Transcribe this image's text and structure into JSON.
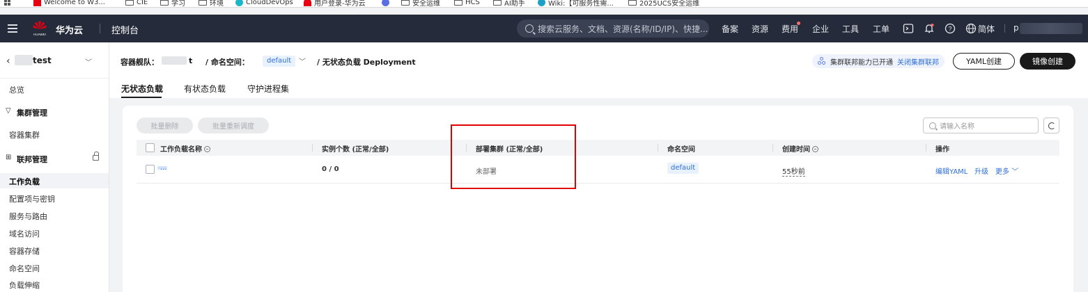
{
  "bookmarks": [
    {
      "label": "Welcome to W3...",
      "icon": "w3-icon"
    },
    {
      "label": "CIE",
      "icon": "folder-icon"
    },
    {
      "label": "学习",
      "icon": "folder-icon"
    },
    {
      "label": "环境",
      "icon": "folder-icon"
    },
    {
      "label": "CloudDevOps",
      "icon": "clouddevops-icon"
    },
    {
      "label": "用户登录-华为云",
      "icon": "huawei-icon"
    },
    {
      "label": "安全运维",
      "icon": "folder-icon"
    },
    {
      "label": "HCS",
      "icon": "folder-icon"
    },
    {
      "label": "AI助手",
      "icon": "folder-icon"
    },
    {
      "label": "Wiki:【可服务性需...",
      "icon": "wiki-icon"
    },
    {
      "label": "2025UCS安全运维",
      "icon": "folder-icon"
    }
  ],
  "topnav": {
    "logo_text": "HUAWEI",
    "brand": "华为云",
    "console": "控制台",
    "search_placeholder": "搜索云服务、文档、资源(名称/ID/IP)、快捷...",
    "links": [
      "备案",
      "资源",
      "费用",
      "企业",
      "工具",
      "工单"
    ],
    "lang": "简体",
    "user_initial": "p"
  },
  "sidebar": {
    "cluster_name": "test",
    "items": [
      {
        "label": "总览",
        "type": "item"
      },
      {
        "label": "集群管理",
        "type": "group"
      },
      {
        "label": "容器集群",
        "type": "item"
      },
      {
        "label": "联邦管理",
        "type": "group"
      },
      {
        "label": "工作负载",
        "type": "active"
      },
      {
        "label": "配置项与密钥",
        "type": "item"
      },
      {
        "label": "服务与路由",
        "type": "item"
      },
      {
        "label": "域名访问",
        "type": "item"
      },
      {
        "label": "容器存储",
        "type": "item"
      },
      {
        "label": "命名空间",
        "type": "item"
      },
      {
        "label": "负载伸缩",
        "type": "item"
      }
    ]
  },
  "header": {
    "fleet_label": "容器舰队：",
    "fleet_suffix": "t",
    "ns_label": "/  命名空间：",
    "ns_value": "default",
    "page_title": "/  无状态负载 Deployment",
    "federation_text": "集群联邦能力已开通",
    "federation_link": "关闭集群联邦",
    "yaml_button": "YAML创建",
    "image_button": "镜像创建",
    "tabs": [
      "无状态负载",
      "有状态负载",
      "守护进程集"
    ]
  },
  "toolbar": {
    "batch_delete": "批量删除",
    "batch_reschedule": "批量重新调度",
    "search_placeholder": "请输入名称"
  },
  "table": {
    "columns": [
      "工作负载名称",
      "实例个数 (正常/全部)",
      "部署集群 (正常/全部)",
      "命名空间",
      "创建时间",
      "操作"
    ],
    "rows": [
      {
        "name": "...",
        "instances": "0 / 0",
        "deploy_clusters": "未部署",
        "namespace": "default",
        "created": "55秒前",
        "actions": [
          "编辑YAML",
          "升级",
          "更多"
        ]
      }
    ]
  },
  "colors": {
    "nav_bg": "#252b3a",
    "accent_blue": "#2f6fd6",
    "highlight_red": "#e00000",
    "huawei_red": "#e60012"
  }
}
